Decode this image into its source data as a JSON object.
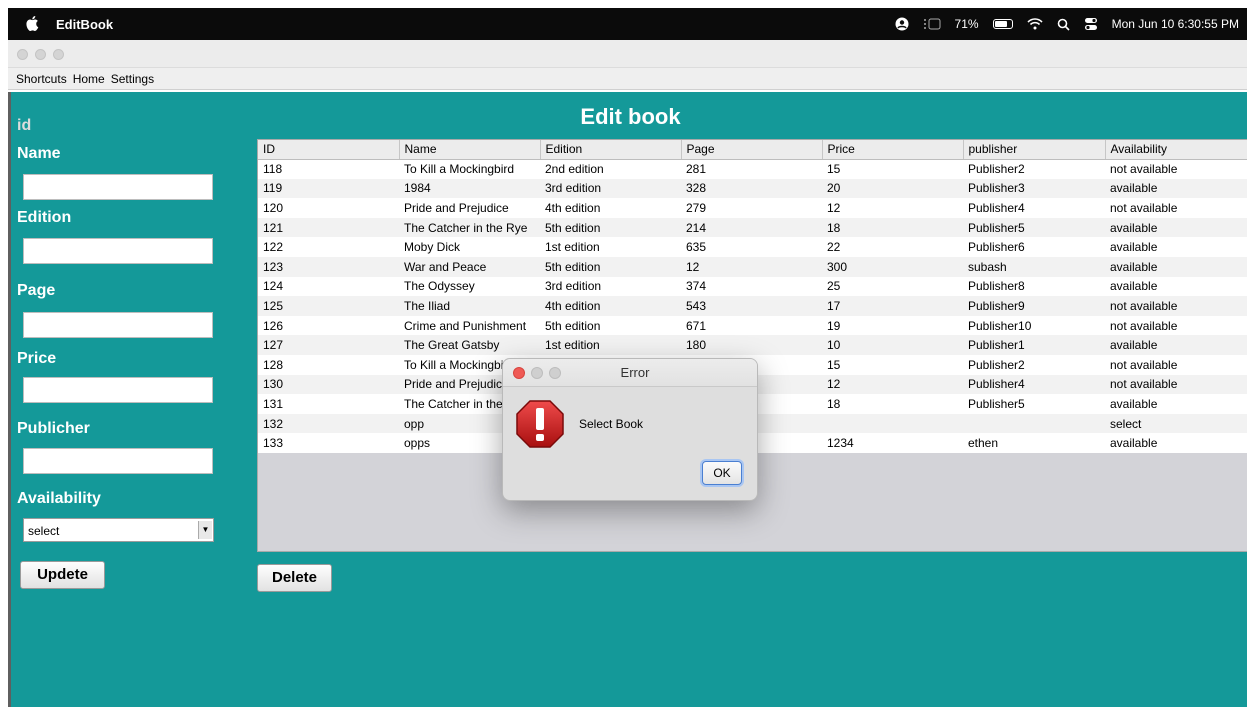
{
  "system": {
    "app_name": "EditBook",
    "battery": "71%",
    "datetime": "Mon Jun 10  6:30:55 PM"
  },
  "menu": [
    "Shortcuts",
    "Home",
    "Settings"
  ],
  "form": {
    "id_label": "id",
    "name_label": "Name",
    "edition_label": "Edition",
    "page_label": "Page",
    "price_label": "Price",
    "publisher_label": "Publicher",
    "availability_label": "Availability",
    "availability_value": "select",
    "update_label": "Updete"
  },
  "main": {
    "title": "Edit book",
    "delete_label": "Delete"
  },
  "table": {
    "columns": [
      "ID",
      "Name",
      "Edition",
      "Page",
      "Price",
      "publisher",
      "Availability"
    ],
    "rows": [
      [
        "118",
        "To Kill a Mockingbird",
        "2nd edition",
        "281",
        "15",
        "Publisher2",
        "not available"
      ],
      [
        "119",
        "1984",
        "3rd edition",
        "328",
        "20",
        "Publisher3",
        "available"
      ],
      [
        "120",
        "Pride and Prejudice",
        "4th edition",
        "279",
        "12",
        "Publisher4",
        "not available"
      ],
      [
        "121",
        "The Catcher in the Rye",
        "5th edition",
        "214",
        "18",
        "Publisher5",
        "available"
      ],
      [
        "122",
        "Moby Dick",
        "1st edition",
        "635",
        "22",
        "Publisher6",
        "available"
      ],
      [
        "123",
        "War and Peace",
        "5th edition",
        "12",
        "300",
        "subash",
        "available"
      ],
      [
        "124",
        "The Odyssey",
        "3rd edition",
        "374",
        "25",
        "Publisher8",
        "available"
      ],
      [
        "125",
        "The Iliad",
        "4th edition",
        "543",
        "17",
        "Publisher9",
        "not available"
      ],
      [
        "126",
        "Crime and Punishment",
        "5th edition",
        "671",
        "19",
        "Publisher10",
        "not available"
      ],
      [
        "127",
        "The Great Gatsby",
        "1st edition",
        "180",
        "10",
        "Publisher1",
        "available"
      ],
      [
        "128",
        "To Kill a Mockingbird",
        "",
        "",
        "15",
        "Publisher2",
        "not available"
      ],
      [
        "130",
        "Pride and Prejudice",
        "",
        "",
        "12",
        "Publisher4",
        "not available"
      ],
      [
        "131",
        "The Catcher in the Rye",
        "",
        "",
        "18",
        "Publisher5",
        "available"
      ],
      [
        "132",
        "opp",
        "",
        "",
        "",
        "",
        "select"
      ],
      [
        "133",
        "opps",
        "",
        "",
        "1234",
        "ethen",
        "available"
      ]
    ]
  },
  "dialog": {
    "title": "Error",
    "message": "Select Book",
    "ok_label": "OK",
    "icon": "warning-icon"
  }
}
